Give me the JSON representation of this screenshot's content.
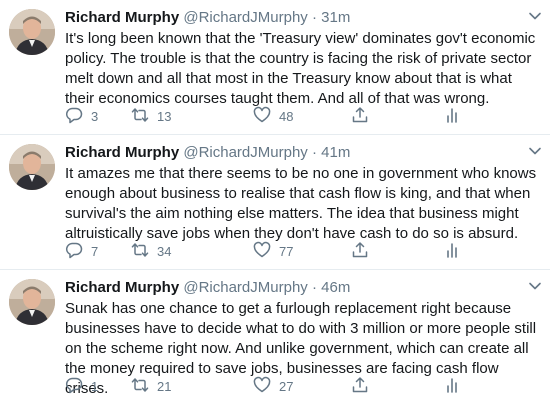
{
  "tweets": [
    {
      "name": "Richard Murphy",
      "handle": "@RichardJMurphy",
      "separator": "·",
      "time": "31m",
      "text": "It's long been known that the 'Treasury view' dominates gov't economic policy. The trouble is that the country is facing the risk of private sector melt down and all that most in the Treasury know about that is what their economics courses taught them. And all of that was wrong.",
      "replies": "3",
      "retweets": "13",
      "likes": "48"
    },
    {
      "name": "Richard Murphy",
      "handle": "@RichardJMurphy",
      "separator": "·",
      "time": "41m",
      "text": "It amazes me that there seems to be no one in government who knows enough about business to realise that cash flow is king, and that when survival's the aim nothing else matters. The idea that business might altruistically save jobs when they don't have cash to do so is absurd.",
      "replies": "7",
      "retweets": "34",
      "likes": "77"
    },
    {
      "name": "Richard Murphy",
      "handle": "@RichardJMurphy",
      "separator": "·",
      "time": "46m",
      "text": "Sunak has one chance to get a furlough replacement right because businesses have to decide what to do with 3 million or more people still on the scheme right now. And unlike government, which can create all the money required to save jobs, businesses are facing cash flow crises.",
      "replies": "1",
      "retweets": "21",
      "likes": "27"
    }
  ],
  "colors": {
    "text": "#14171a",
    "secondary": "#657786",
    "divider": "#e6ecf0"
  },
  "icons": [
    "chevron-down-icon",
    "reply-icon",
    "retweet-icon",
    "like-icon",
    "share-icon",
    "analytics-icon"
  ]
}
